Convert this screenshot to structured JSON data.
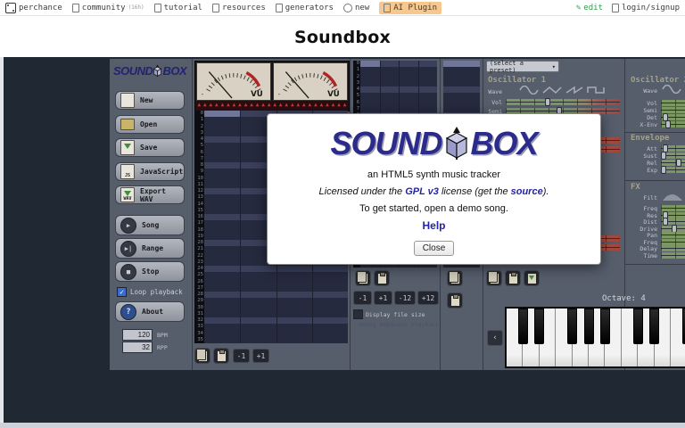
{
  "navbar": {
    "brand": "perchance",
    "links": [
      {
        "label": "community",
        "suffix": "(16h)",
        "icon": "speech-bubble-icon"
      },
      {
        "label": "tutorial",
        "icon": "book-icon"
      },
      {
        "label": "resources",
        "icon": "book-icon"
      },
      {
        "label": "generators",
        "icon": "grid-icon"
      },
      {
        "label": "new",
        "icon": "plus-globe-icon"
      },
      {
        "label": "AI Plugin",
        "icon": "plug-icon",
        "pill": true
      }
    ],
    "right": [
      {
        "label": "edit",
        "icon": "pencil-icon",
        "green": true
      },
      {
        "label": "login/signup",
        "icon": "user-icon"
      }
    ]
  },
  "page": {
    "title": "Soundbox"
  },
  "app": {
    "logo": {
      "part1": "SOUND",
      "part2": "BOX"
    },
    "sidebar": {
      "file_buttons": [
        {
          "label": "New",
          "icon": "new-file-icon"
        },
        {
          "label": "Open",
          "icon": "open-folder-icon"
        },
        {
          "label": "Save",
          "icon": "save-icon"
        },
        {
          "label": "JavaScript",
          "icon": "javascript-icon"
        },
        {
          "label": "Export WAV",
          "icon": "export-wav-icon"
        }
      ],
      "transport_buttons": [
        {
          "label": "Song",
          "icon": "play-icon",
          "glyph": "▶"
        },
        {
          "label": "Range",
          "icon": "play-range-icon",
          "glyph": "▶|"
        },
        {
          "label": "Stop",
          "icon": "stop-icon",
          "glyph": "■"
        }
      ],
      "loop_playback": {
        "label": "Loop playback",
        "checked": true
      },
      "about": {
        "label": "About",
        "glyph": "?"
      },
      "bpm": {
        "value": "120",
        "label": "BPM"
      },
      "rpp": {
        "value": "32",
        "label": "RPP"
      }
    },
    "vu": {
      "label": "VU",
      "led_count": 26
    },
    "sequencer": {
      "row_count": 36,
      "col_count": 4,
      "selected": [
        0,
        0
      ],
      "buttons": [
        "-1",
        "+1"
      ]
    },
    "pattern": {
      "row_count": 32,
      "col_count": 4,
      "selected": [
        0,
        0
      ],
      "buttons": [
        "-1",
        "+1",
        "-12",
        "+12"
      ],
      "display_file_size": {
        "label": "Display file size",
        "checked": false
      },
      "status_text": "Using WebAudio playback"
    },
    "fxtrack": {
      "row_count": 32,
      "selected": 0
    },
    "instrument": {
      "preset_placeholder": "(select a preset)",
      "osc1": {
        "title": "Oscillator 1",
        "wave_label": "Wave",
        "sliders": [
          {
            "label": "Vol",
            "value": 0.37
          },
          {
            "label": "Semi",
            "value": 0.47
          }
        ]
      },
      "osc2": {
        "title": "Oscillator 2",
        "wave_label": "Wave",
        "sliders": [
          {
            "label": "Vol",
            "value": 0.8
          },
          {
            "label": "Semi",
            "value": 0.5
          },
          {
            "label": "Det",
            "value": 0.03
          },
          {
            "label": "X-Env",
            "value": 0.05
          }
        ]
      },
      "envelope": {
        "title": "Envelope",
        "sliders": [
          {
            "label": "Att",
            "value": 0.03
          },
          {
            "label": "Sust",
            "value": 0.02
          },
          {
            "label": "Rel",
            "value": 0.13
          },
          {
            "label": "Exp",
            "value": 0.02
          }
        ]
      },
      "fx": {
        "title": "FX",
        "filter_label": "Filt",
        "sliders": [
          {
            "label": "Freq",
            "value": 0.9
          },
          {
            "label": "Res",
            "value": 0.03
          },
          {
            "label": "Dist",
            "value": 0.03
          },
          {
            "label": "Drive",
            "value": 0.1
          },
          {
            "label": "Pan",
            "value": 0.9
          },
          {
            "label": "Freq",
            "value": 0.9
          },
          {
            "label": "Delay",
            "value": 0.9
          },
          {
            "label": "Time",
            "value": 0.9
          }
        ]
      },
      "octave_label": "Octave:",
      "octave_value": "4",
      "keyboard": {
        "white_keys": 11
      }
    }
  },
  "dialog": {
    "tagline": "an HTML5 synth music tracker",
    "license": {
      "pre": "Licensed under the ",
      "link1": "GPL v3",
      "mid": " license (get the ",
      "link2": "source",
      "post": ")."
    },
    "start_text": "To get started, open a demo song.",
    "help_label": "Help",
    "close_label": "Close"
  },
  "colors": {
    "accent_link": "#2424a8",
    "logo_blue": "#2b2b8c",
    "panel": "#565d6b",
    "grid_bg": "#262a3e",
    "grid_stripe": "#3a3f5a",
    "grid_selected": "#707698",
    "slider_green": "#7c9763",
    "slider_red": "#9d463d",
    "ai_pill": "#f6c78e",
    "edit_green": "#2e9e4f"
  }
}
